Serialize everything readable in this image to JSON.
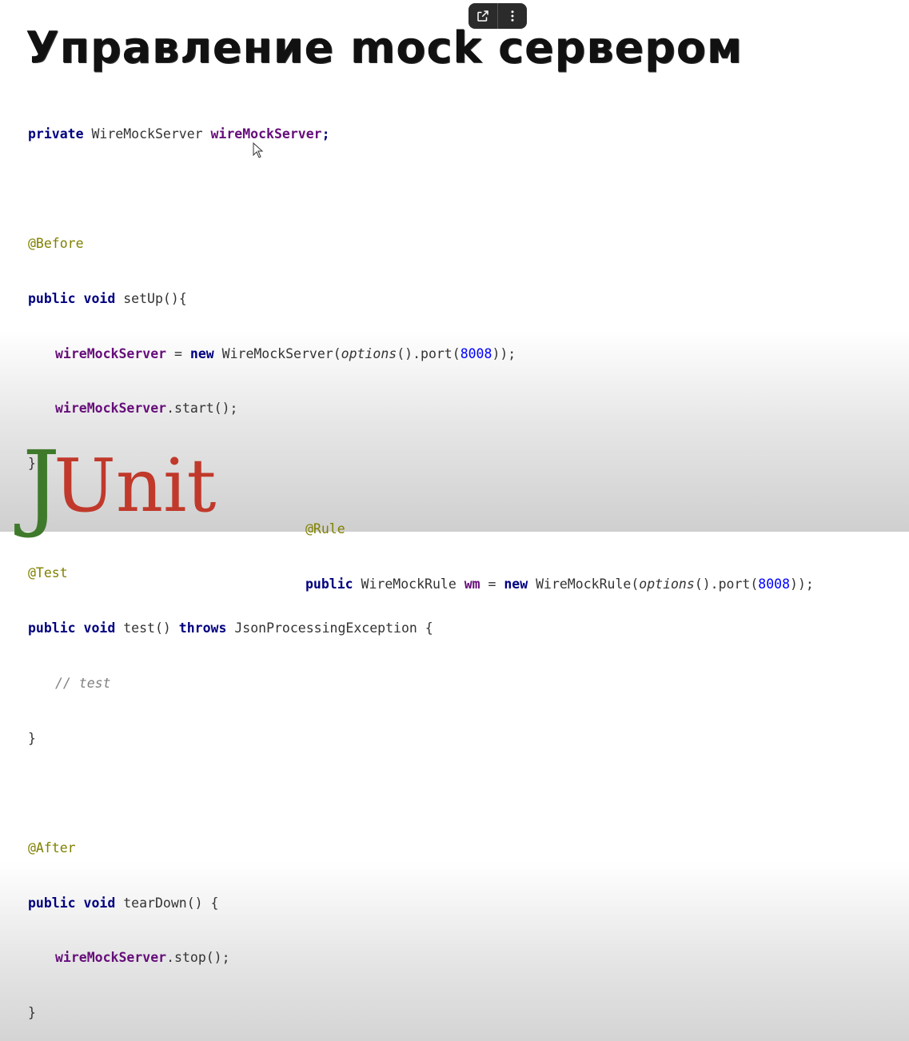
{
  "toolbar": {
    "open_external_icon": "external-link-icon",
    "more_icon": "more-vertical-icon"
  },
  "slide": {
    "title": "Управление mock сервером",
    "code": {
      "field_decl": {
        "private": "private",
        "type": "WireMockServer",
        "name": "wireMockServer",
        "end": ";"
      },
      "before_ann": "@Before",
      "setup_sig": {
        "public": "public",
        "void": "void",
        "name": "setUp(){"
      },
      "setup_l1": {
        "field": "wireMockServer",
        "eq": " = ",
        "new": "new",
        "ctor": " WireMockServer(",
        "options": "options",
        "port": "().port(",
        "num": "8008",
        "end": "));"
      },
      "setup_l2": {
        "field": "wireMockServer",
        "call": ".start();"
      },
      "close1": "}",
      "test_ann": "@Test",
      "test_sig": {
        "public": "public",
        "void": "void",
        "name": "test()",
        "throws": "throws",
        "exc": "JsonProcessingException {"
      },
      "test_comment": "// test",
      "close2": "}",
      "after_ann": "@After",
      "teardown_sig": {
        "public": "public",
        "void": "void",
        "name": "tearDown() {"
      },
      "teardown_l1": {
        "field": "wireMockServer",
        "call": ".stop();"
      },
      "close3": "}"
    },
    "junit_logo": {
      "j": "J",
      "u": "U",
      "rest": "nit"
    },
    "rule": {
      "ann": "@Rule",
      "public": "public",
      "type": " WireMockRule ",
      "var": "wm",
      "eq": " = ",
      "new": "new",
      "ctor": " WireMockRule(",
      "options": "options",
      "port": "().port(",
      "num": "8008",
      "end": "));"
    }
  },
  "colors": {
    "keyword": "#000080",
    "field": "#660e7a",
    "annotation": "#808000",
    "number": "#0000ff",
    "junit_green": "#3f7a2c",
    "junit_red": "#c0392b"
  }
}
